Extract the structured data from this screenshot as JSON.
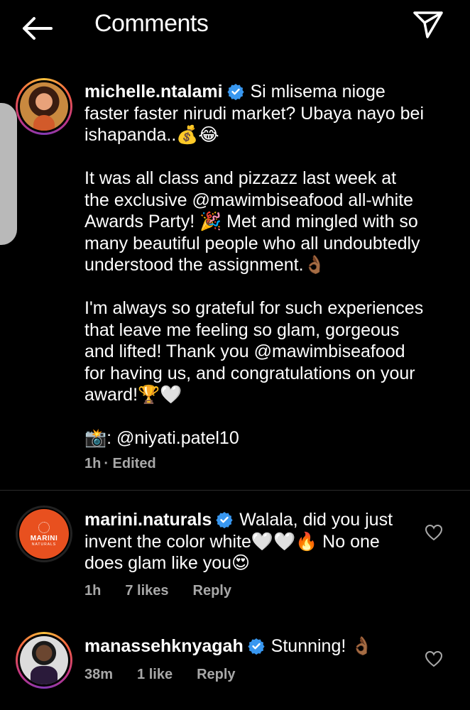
{
  "header": {
    "title": "Comments",
    "back_icon": "arrow-left-icon",
    "send_icon": "paper-plane-icon"
  },
  "caption": {
    "username": "michelle.ntalami",
    "line1": "Si mlisema nioge",
    "text_rest": "faster faster nirudi market? Ubaya nayo bei\nishapanda..💰😂\n\nIt was all class and pizzazz last week at\nthe exclusive @mawimbiseafood all-white\nAwards Party! 🎉 Met and mingled with so\nmany beautiful people who all undoubtedly\nunderstood the assignment.👌🏾\n\nI'm always so grateful for such experiences\nthat leave me feeling so glam, gorgeous\nand lifted! Thank you @mawimbiseafood\nfor having us, and congratulations on your\naward!🏆🤍\n\n📸: @niyati.patel10",
    "time": "1h",
    "edited": "· Edited"
  },
  "comments": [
    {
      "username": "marini.naturals",
      "line1": "Walala, did you just",
      "text_rest": "invent the color white🤍🤍🔥 No one\ndoes glam like you😍",
      "time": "1h",
      "likes": "7 likes",
      "reply": "Reply",
      "avatar_text": "MARINI",
      "avatar_sub": "NATURALS"
    },
    {
      "username": "manassehknyagah",
      "line1": "Stunning! 👌🏾",
      "time": "38m",
      "likes": "1 like",
      "reply": "Reply"
    }
  ],
  "colors": {
    "background": "#000000",
    "verified": "#3897f0",
    "meta": "#a8a8a8",
    "marini_orange": "#e8501f"
  }
}
